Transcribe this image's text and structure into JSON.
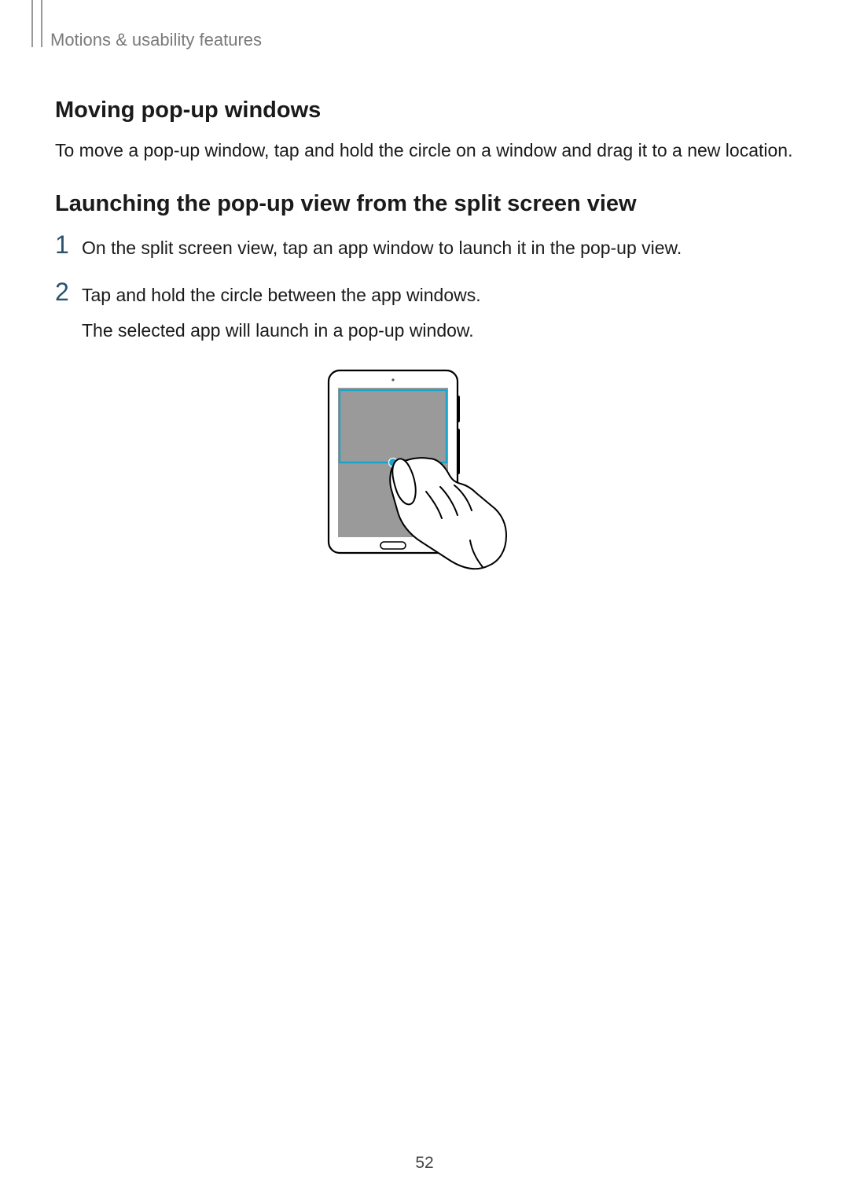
{
  "header": "Motions & usability features",
  "section1": {
    "title": "Moving pop-up windows",
    "body": "To move a pop-up window, tap and hold the circle on a window and drag it to a new location."
  },
  "section2": {
    "title": "Launching the pop-up view from the split screen view",
    "steps": [
      {
        "num": "1",
        "text": "On the split screen view, tap an app window to launch it in the pop-up view."
      },
      {
        "num": "2",
        "text": "Tap and hold the circle between the app windows.",
        "sub": "The selected app will launch in a pop-up window."
      }
    ]
  },
  "pageNumber": "52"
}
